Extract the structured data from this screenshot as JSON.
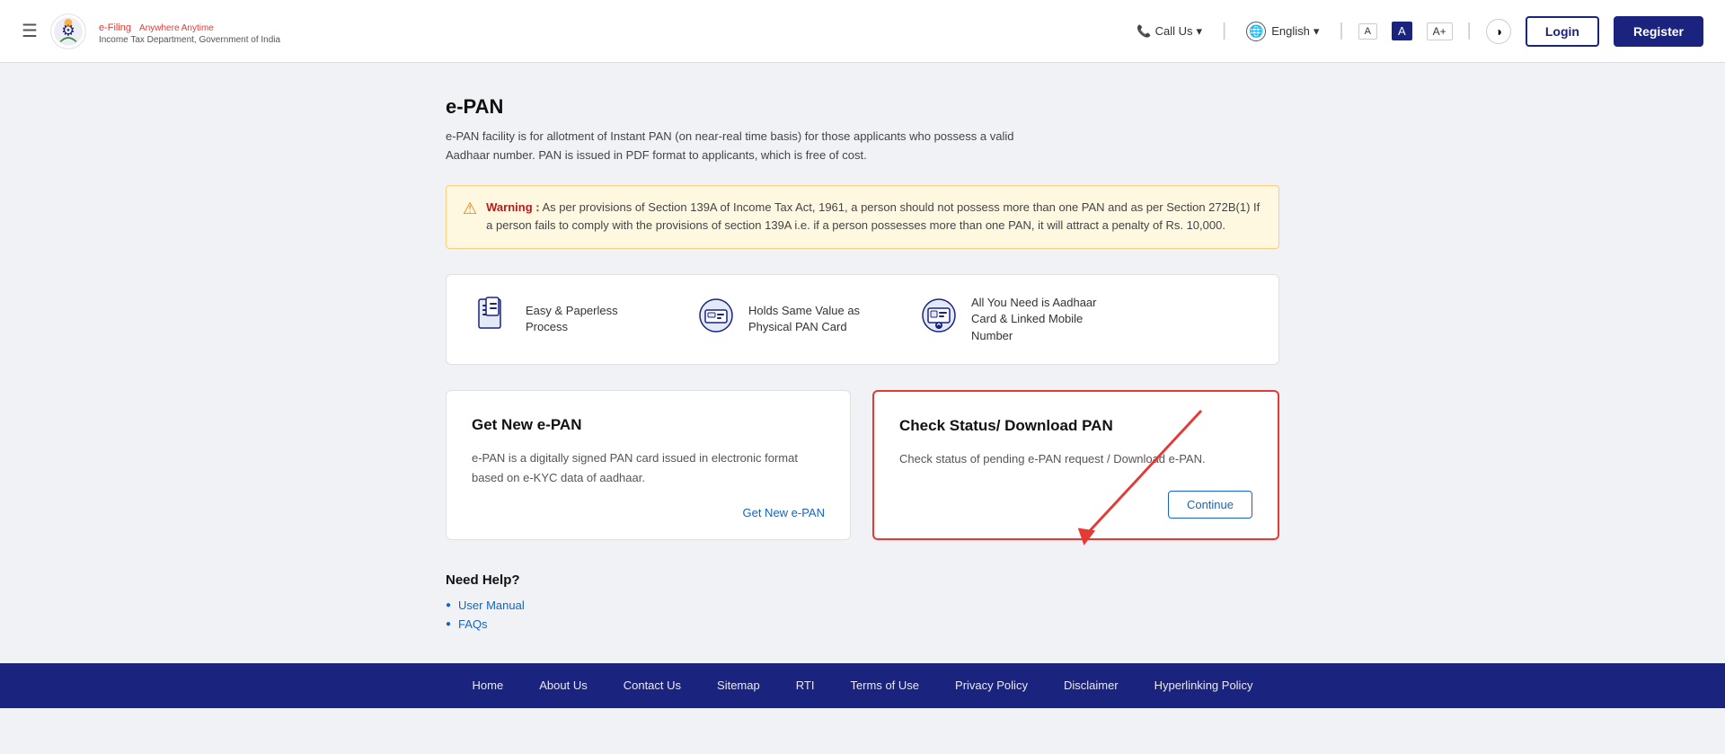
{
  "header": {
    "hamburger_label": "☰",
    "logo_title": "e-Filing",
    "logo_tagline": "Anywhere Anytime",
    "logo_subtitle": "Income Tax Department, Government of India",
    "call_us": "Call Us",
    "language": "English",
    "font_small": "A",
    "font_medium": "A",
    "font_large": "A+",
    "contrast": "◑",
    "login_label": "Login",
    "register_label": "Register"
  },
  "page": {
    "title": "e-PAN",
    "description": "e-PAN facility is for allotment of Instant PAN (on near-real time basis) for those applicants who possess a valid Aadhaar number. PAN is issued in PDF format to applicants, which is free of cost."
  },
  "warning": {
    "icon": "⚠",
    "label": "Warning :",
    "text": "As per provisions of Section 139A of Income Tax Act, 1961, a person should not possess more than one PAN and as per Section 272B(1) If a person fails to comply with the provisions of section 139A i.e. if a person possesses more than one PAN, it will attract a penalty of Rs. 10,000."
  },
  "features": [
    {
      "icon": "📄",
      "label": "Easy & Paperless Process"
    },
    {
      "icon": "💳",
      "label": "Holds Same Value as Physical PAN Card"
    },
    {
      "icon": "📋",
      "label": "All You Need is Aadhaar Card & Linked Mobile Number"
    }
  ],
  "cards": [
    {
      "id": "get-new",
      "title": "Get New e-PAN",
      "description": "e-PAN is a digitally signed PAN card issued in electronic format based on e-KYC data of aadhaar.",
      "action_label": "Get New e-PAN",
      "highlighted": false
    },
    {
      "id": "check-status",
      "title": "Check Status/ Download PAN",
      "description": "Check status of pending e-PAN request / Download e-PAN.",
      "action_label": "Continue",
      "highlighted": true
    }
  ],
  "help": {
    "title": "Need Help?",
    "links": [
      {
        "label": "User Manual"
      },
      {
        "label": "FAQs"
      }
    ]
  },
  "bottom_nav": [
    "Home",
    "About Us",
    "Contact Us",
    "Sitemap",
    "RTI",
    "Terms of Use",
    "Privacy Policy",
    "Disclaimer",
    "Hyperlinking Policy"
  ]
}
